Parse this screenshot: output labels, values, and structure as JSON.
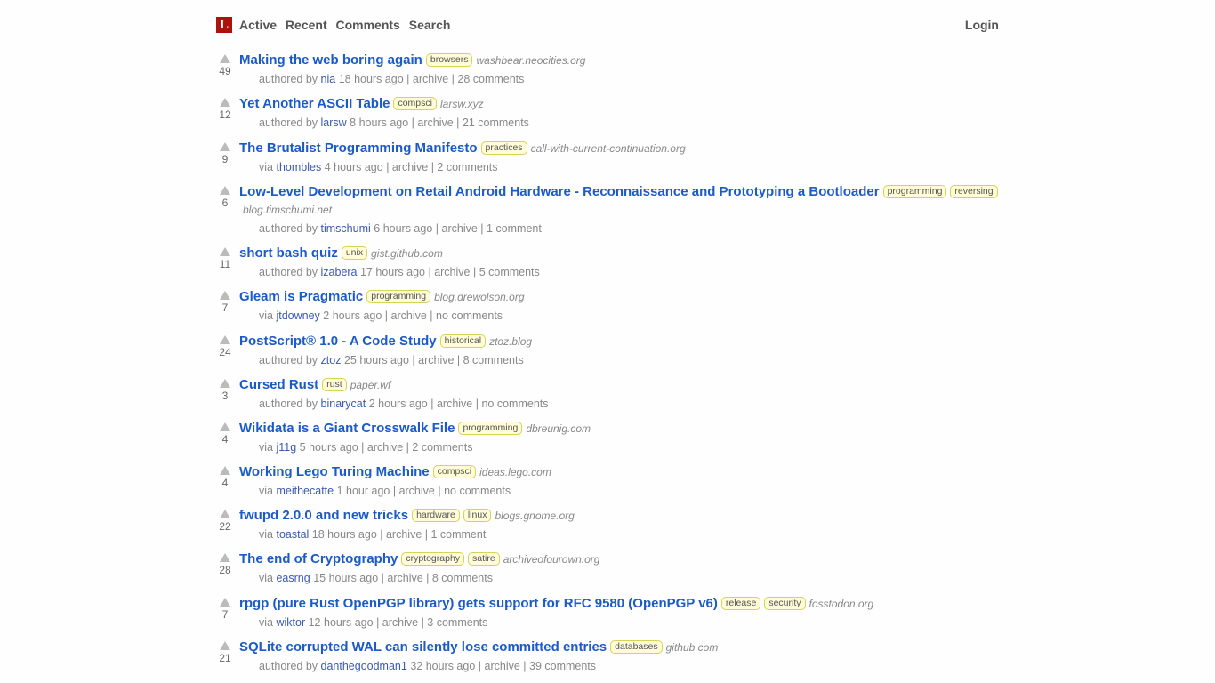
{
  "header": {
    "logo_letter": "L",
    "nav": [
      "Active",
      "Recent",
      "Comments",
      "Search"
    ],
    "login": "Login"
  },
  "stories": [
    {
      "title": "Making the web boring again",
      "tags": [
        "browsers"
      ],
      "domain": "washbear.neocities.org",
      "score": "49",
      "byline": {
        "prefix": "authored by",
        "user": "nia",
        "time": "18 hours ago",
        "archive": "archive",
        "comments": "28 comments"
      }
    },
    {
      "title": "Yet Another ASCII Table",
      "tags": [
        "compsci"
      ],
      "domain": "larsw.xyz",
      "score": "12",
      "byline": {
        "prefix": "authored by",
        "user": "larsw",
        "time": "8 hours ago",
        "archive": "archive",
        "comments": "21 comments"
      }
    },
    {
      "title": "The Brutalist Programming Manifesto",
      "tags": [
        "practices"
      ],
      "domain": "call-with-current-continuation.org",
      "score": "9",
      "byline": {
        "prefix": "via",
        "user": "thombles",
        "time": "4 hours ago",
        "archive": "archive",
        "comments": "2 comments"
      }
    },
    {
      "title": "Low-Level Development on Retail Android Hardware - Reconnaissance and Prototyping a Bootloader",
      "tags": [
        "programming",
        "reversing"
      ],
      "domain": "blog.timschumi.net",
      "score": "6",
      "byline": {
        "prefix": "authored by",
        "user": "timschumi",
        "time": "6 hours ago",
        "archive": "archive",
        "comments": "1 comment"
      }
    },
    {
      "title": "short bash quiz",
      "tags": [
        "unix"
      ],
      "domain": "gist.github.com",
      "score": "11",
      "byline": {
        "prefix": "authored by",
        "user": "izabera",
        "time": "17 hours ago",
        "archive": "archive",
        "comments": "5 comments"
      }
    },
    {
      "title": "Gleam is Pragmatic",
      "tags": [
        "programming"
      ],
      "domain": "blog.drewolson.org",
      "score": "7",
      "byline": {
        "prefix": "via",
        "user": "jtdowney",
        "time": "2 hours ago",
        "archive": "archive",
        "comments": "no comments"
      }
    },
    {
      "title": "PostScript® 1.0 - A Code Study",
      "tags": [
        "historical"
      ],
      "domain": "ztoz.blog",
      "score": "24",
      "byline": {
        "prefix": "authored by",
        "user": "ztoz",
        "time": "25 hours ago",
        "archive": "archive",
        "comments": "8 comments"
      }
    },
    {
      "title": "Cursed Rust",
      "tags": [
        "rust"
      ],
      "domain": "paper.wf",
      "score": "3",
      "byline": {
        "prefix": "authored by",
        "user": "binarycat",
        "time": "2 hours ago",
        "archive": "archive",
        "comments": "no comments"
      }
    },
    {
      "title": "Wikidata is a Giant Crosswalk File",
      "tags": [
        "programming"
      ],
      "domain": "dbreunig.com",
      "score": "4",
      "byline": {
        "prefix": "via",
        "user": "j11g",
        "time": "5 hours ago",
        "archive": "archive",
        "comments": "2 comments"
      }
    },
    {
      "title": "Working Lego Turing Machine",
      "tags": [
        "compsci"
      ],
      "domain": "ideas.lego.com",
      "score": "4",
      "byline": {
        "prefix": "via",
        "user": "meithecatte",
        "time": "1 hour ago",
        "archive": "archive",
        "comments": "no comments"
      }
    },
    {
      "title": "fwupd 2.0.0 and new tricks",
      "tags": [
        "hardware",
        "linux"
      ],
      "domain": "blogs.gnome.org",
      "score": "22",
      "byline": {
        "prefix": "via",
        "user": "toastal",
        "time": "18 hours ago",
        "archive": "archive",
        "comments": "1 comment"
      }
    },
    {
      "title": "The end of Cryptography",
      "tags": [
        "cryptography",
        "satire"
      ],
      "domain": "archiveofourown.org",
      "score": "28",
      "byline": {
        "prefix": "via",
        "user": "easrng",
        "time": "15 hours ago",
        "archive": "archive",
        "comments": "8 comments"
      }
    },
    {
      "title": "rpgp (pure Rust OpenPGP library) gets support for RFC 9580 (OpenPGP v6)",
      "tags": [
        "release",
        "security"
      ],
      "domain": "fosstodon.org",
      "score": "7",
      "byline": {
        "prefix": "via",
        "user": "wiktor",
        "time": "12 hours ago",
        "archive": "archive",
        "comments": "3 comments"
      }
    },
    {
      "title": "SQLite corrupted WAL can silently lose committed entries",
      "tags": [
        "databases"
      ],
      "domain": "github.com",
      "score": "21",
      "byline": {
        "prefix": "authored by",
        "user": "danthegoodman1",
        "time": "32 hours ago",
        "archive": "archive",
        "comments": "39 comments"
      }
    }
  ]
}
